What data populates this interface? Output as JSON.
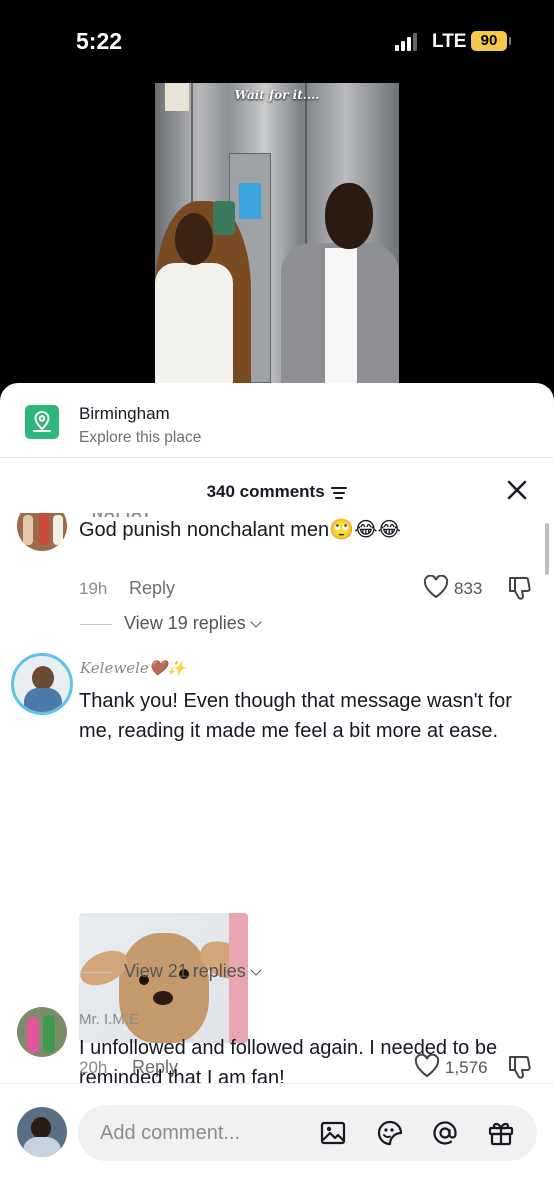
{
  "status_bar": {
    "time": "5:22",
    "network": "LTE",
    "battery": "90"
  },
  "video": {
    "caption": "Wait for it...."
  },
  "place": {
    "name": "Birmingham",
    "subtitle": "Explore this place",
    "icon": "location-pin-icon"
  },
  "comments_header": {
    "count_label": "340 comments"
  },
  "comments": [
    {
      "username": "NAFIAT",
      "text": "God punish nonchalant men🙄😂😂",
      "time": "19h",
      "reply_label": "Reply",
      "likes": "833",
      "view_replies": "View 19 replies"
    },
    {
      "username": "Kelewele🤎✨",
      "text": "Thank you! Even though that message wasn't for me, reading it made me feel a bit more at ease.",
      "time": "20h",
      "reply_label": "Reply",
      "likes": "1,576",
      "view_replies": "View 21 replies"
    },
    {
      "username": "Mr. I.M.E",
      "text": "I unfollowed and followed again. I needed to be reminded that I am fan!"
    }
  ],
  "composer": {
    "placeholder": "Add comment..."
  },
  "colors": {
    "accent_green": "#2fb67c",
    "battery": "#f5c84a"
  }
}
